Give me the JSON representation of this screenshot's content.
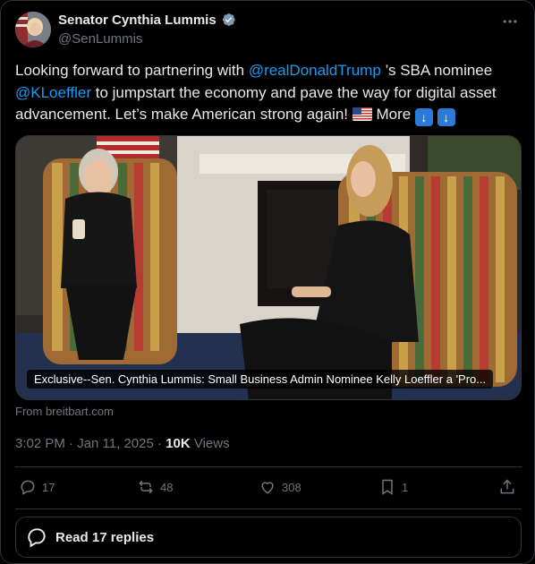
{
  "author": {
    "name": "Senator Cynthia Lummis",
    "handle": "@SenLummis"
  },
  "tweet": {
    "text_1": "Looking forward to partnering with ",
    "mention_1": "@realDonaldTrump",
    "text_2": " ’s SBA nominee ",
    "mention_2": "@KLoeffler",
    "text_3": " to jumpstart the economy and pave the way for digital asset advancement. Let’s make American strong again! ",
    "more_label": " More ",
    "flag_icon": "us-flag-icon",
    "arrow_icon": "down-arrow-icon"
  },
  "media": {
    "caption": "Exclusive--Sen. Cynthia Lummis: Small Business Admin Nominee Kelly Loeffler a 'Pro...",
    "source": "From breitbart.com"
  },
  "meta": {
    "time": "3:02 PM · Jan 11, 2025 · ",
    "views_count": "10K",
    "views_label": " Views"
  },
  "actions": {
    "replies": "17",
    "reposts": "48",
    "likes": "308",
    "bookmarks": "1"
  },
  "read_replies": "Read 17 replies",
  "colors": {
    "accent": "#1d9bf0",
    "background": "#000000",
    "muted": "#71767b",
    "border": "#2f3336"
  }
}
